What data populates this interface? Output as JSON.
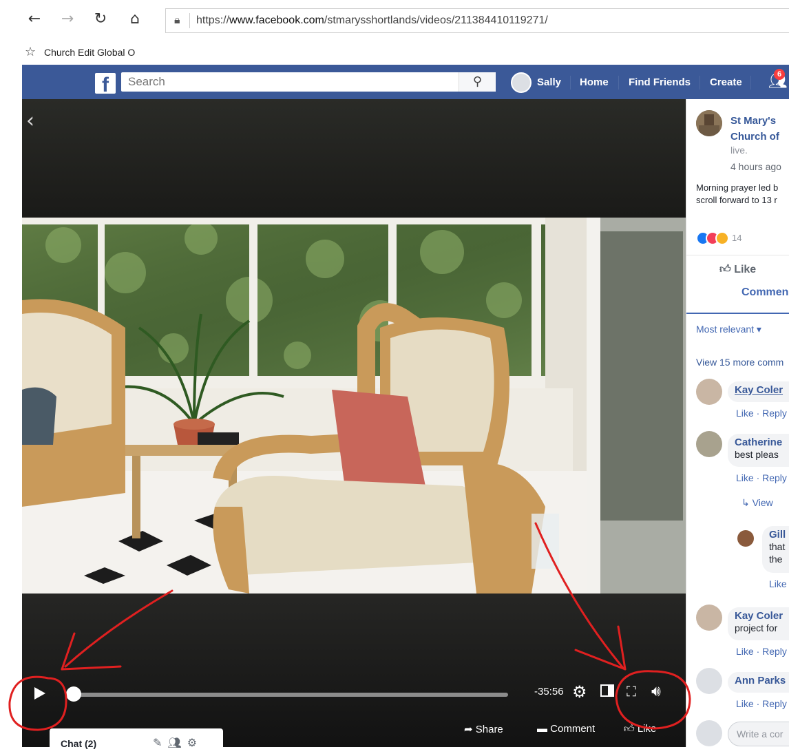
{
  "browser": {
    "url": "https://www.facebook.com/stmarysshortlands/videos/211384410119271/",
    "url_prefix": "https://",
    "url_domain": "www.facebook.com",
    "url_path": "/stmarysshortlands/videos/211384410119271/",
    "favorite_label": "Church Edit Global O"
  },
  "fb": {
    "search_placeholder": "Search",
    "user_name": "Sally",
    "nav": [
      "Home",
      "Find Friends",
      "Create"
    ],
    "friend_requests": "6"
  },
  "video": {
    "time_remaining": "-35:56",
    "progress_fraction": 0.0,
    "share_label": "Share",
    "comment_label": "Comment",
    "like_label": "Like",
    "chat_label": "Chat (2)"
  },
  "post": {
    "page_name_1": "St Mary's",
    "page_name_2": "Church of",
    "status": "live.",
    "time": "4 hours ago",
    "desc_1": "Morning prayer led b",
    "desc_2": "scroll forward to 13 r",
    "reaction_count": "14",
    "like_label": "Like",
    "comment_label": "Commen",
    "sort_label": "Most relevant ▾",
    "view_more": "View 15 more comm"
  },
  "comments": [
    {
      "name": "Kay Coler",
      "text": "",
      "actions": "Like · Reply"
    },
    {
      "name": "Catherine",
      "text": "best pleas",
      "actions": "Like · Reply",
      "view_replies": "View"
    },
    {
      "name": "Gill",
      "text_1": "that",
      "text_2": "the",
      "actions": "Like"
    },
    {
      "name": "Kay Coler",
      "text": "project for",
      "actions": "Like · Reply"
    },
    {
      "name": "Ann Parks",
      "text": "",
      "actions": "Like · Reply"
    }
  ],
  "write_comment_placeholder": "Write a cor",
  "colors": {
    "fb_blue": "#3b5998",
    "link_blue": "#365899",
    "annotation_red": "#e02020"
  }
}
